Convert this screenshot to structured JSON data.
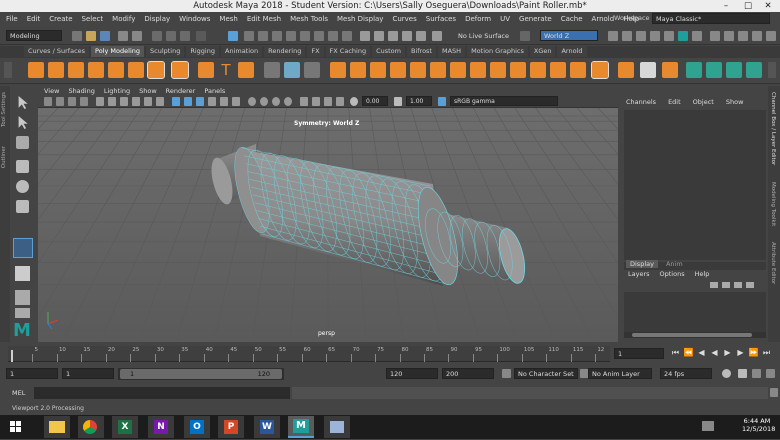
{
  "window": {
    "title": "Autodesk Maya 2018 - Student Version: C:\\Users\\Sally Oseguera\\Downloads\\Paint Roller.mb*"
  },
  "menubar": [
    "File",
    "Edit",
    "Create",
    "Select",
    "Modify",
    "Display",
    "Windows",
    "Mesh",
    "Edit Mesh",
    "Mesh Tools",
    "Mesh Display",
    "Curves",
    "Surfaces",
    "Deform",
    "UV",
    "Generate",
    "Cache",
    "Arnold",
    "Help"
  ],
  "workspace": {
    "label": "Workspace :",
    "value": "Maya Classic*"
  },
  "statusline": {
    "mode": "Modeling",
    "live_surface": "No Live Surface",
    "symmetry": "World Z"
  },
  "shelf_tabs": [
    "Curves / Surfaces",
    "Poly Modeling",
    "Sculpting",
    "Rigging",
    "Animation",
    "Rendering",
    "FX",
    "FX Caching",
    "Custom",
    "Bifrost",
    "MASH",
    "Motion Graphics",
    "XGen",
    "Arnold"
  ],
  "active_shelf_tab": "Poly Modeling",
  "side_tabs": [
    "Tool Settings",
    "Outliner"
  ],
  "right_side_tabs": [
    "Channel Box / Layer Editor",
    "Modeling Toolkit",
    "Attribute Editor"
  ],
  "viewport": {
    "menu": [
      "View",
      "Shading",
      "Lighting",
      "Show",
      "Renderer",
      "Panels"
    ],
    "exposure": "0.00",
    "gamma": "1.00",
    "color_space": "sRGB gamma",
    "symmetry_label": "Symmetry: World Z",
    "camera_label": "persp"
  },
  "channelbox": {
    "menu": [
      "Channels",
      "Edit",
      "Object",
      "Show"
    ]
  },
  "layereditor": {
    "tabs": [
      "Display",
      "Anim"
    ],
    "menu": [
      "Layers",
      "Options",
      "Help"
    ]
  },
  "timeline": {
    "ticks": [
      "5",
      "10",
      "15",
      "20",
      "25",
      "30",
      "35",
      "40",
      "45",
      "50",
      "55",
      "60",
      "65",
      "70",
      "75",
      "80",
      "85",
      "90",
      "95",
      "100",
      "105",
      "110",
      "115",
      "12"
    ],
    "current_frame": "1"
  },
  "range": {
    "start": "1",
    "playback_start": "1",
    "slider_start": "1",
    "slider_end": "120",
    "playback_end": "120",
    "end": "200",
    "character_set": "No Character Set",
    "anim_layer": "No Anim Layer",
    "fps": "24 fps"
  },
  "mel": {
    "label": "MEL"
  },
  "helpline": "Viewport 2.0 Processing",
  "taskbar": {
    "time": "6:44 AM",
    "date": "12/5/2018",
    "apps": [
      "file-explorer",
      "chrome",
      "excel",
      "onenote",
      "outlook",
      "powerpoint",
      "word",
      "maya",
      "unknown-app"
    ]
  },
  "colors": {
    "accent_blue": "#5aa0d8",
    "maya_teal": "#1f9e9c",
    "wire_cyan": "#6fd3e0",
    "orange_icon": "#e8892e"
  }
}
